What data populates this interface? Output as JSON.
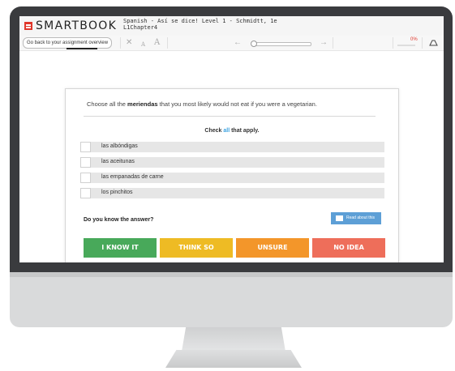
{
  "app": {
    "logo_text": "SMARTBOOK",
    "book_title_line1": "Spanish - Así se dice! Level 1 - Schmidtt, 1e",
    "book_title_line2": "L1Chapter4"
  },
  "toolbar": {
    "back_label": "Go back to your assignment overview",
    "tools": [
      "highlight-off-icon",
      "font-decrease-icon",
      "font-increase-icon",
      "arrow-left-icon",
      "arrow-right-icon",
      "tag-icon"
    ],
    "progress_text": "0%",
    "progress_value": 0,
    "slider_position": 0
  },
  "question": {
    "prompt_before": "Choose all the ",
    "prompt_bold": "meriendas",
    "prompt_after": " that you most likely would not eat if you were a vegetarian.",
    "check_prefix": "Check ",
    "check_all": "all",
    "check_suffix": " that apply.",
    "options": [
      "las albóndigas",
      "las aceitunas",
      "las empanadas de carne",
      "los pinchitos"
    ]
  },
  "confidence": {
    "prompt": "Do you know the answer?",
    "read_about_label": "Read about this",
    "buttons": [
      {
        "label": "I KNOW IT",
        "color": "#48a95a"
      },
      {
        "label": "THINK SO",
        "color": "#eebb24"
      },
      {
        "label": "UNSURE",
        "color": "#f3962a"
      },
      {
        "label": "NO IDEA",
        "color": "#ee6e5a"
      }
    ]
  },
  "colors": {
    "brand_red": "#e0372b",
    "accent_blue": "#3aa1e0",
    "monitor_frame": "#3a3b3e"
  }
}
